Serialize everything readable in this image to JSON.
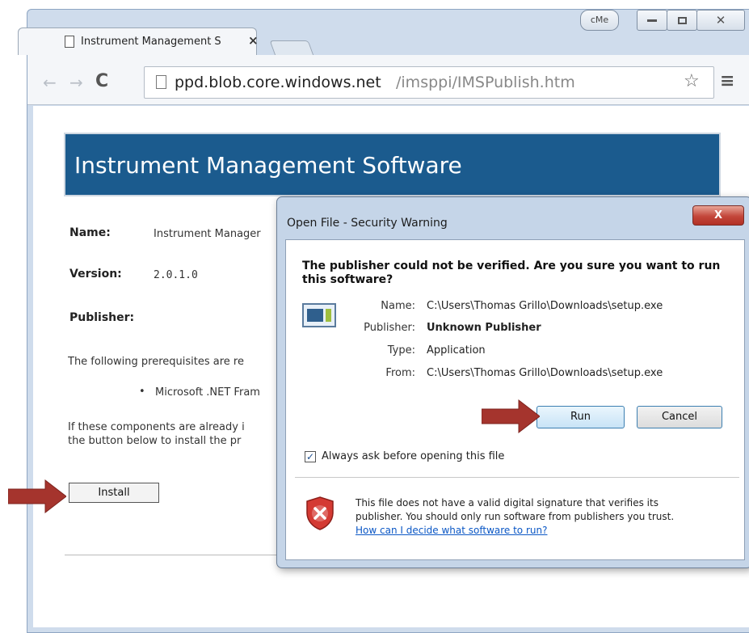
{
  "browser": {
    "tab_title": "Instrument Management S",
    "tab_close": "×",
    "window_badge": "cMe",
    "url_host": "ppd.blob.core.windows.net",
    "url_path": "/imsppi/IMSPublish.htm"
  },
  "page": {
    "banner_title": "Instrument Management Software",
    "fields": [
      {
        "label": "Name:",
        "value": "Instrument Manager"
      },
      {
        "label": "Version:",
        "value": "2.0.1.0"
      },
      {
        "label": "Publisher:",
        "value": ""
      }
    ],
    "prereq_text": "The following prerequisites are re",
    "prereq_item": "Microsoft .NET Fram",
    "info_line1": "If these components are already i",
    "info_line2": "the button below to install the pr",
    "install_label": "Install"
  },
  "dialog": {
    "title": "Open File - Security Warning",
    "close_label": "X",
    "question": "The publisher could not be verified.  Are you sure you want to run this software?",
    "rows": [
      {
        "label": "Name:",
        "value": "C:\\Users\\Thomas Grillo\\Downloads\\setup.exe"
      },
      {
        "label": "Publisher:",
        "value": "Unknown Publisher"
      },
      {
        "label": "Type:",
        "value": "Application"
      },
      {
        "label": "From:",
        "value": "C:\\Users\\Thomas Grillo\\Downloads\\setup.exe"
      }
    ],
    "run_label": "Run",
    "cancel_label": "Cancel",
    "always_ask_label": "Always ask before opening this file",
    "always_ask_checked": true,
    "warning_text_1": "This file does not have a valid digital signature that verifies its",
    "warning_text_2": "publisher.  You should only run software from publishers you trust.",
    "help_link": "How can I decide what software to run?"
  },
  "colors": {
    "banner": "#1b5b8e",
    "arrow": "#a5342d",
    "link": "#0b57c5"
  }
}
